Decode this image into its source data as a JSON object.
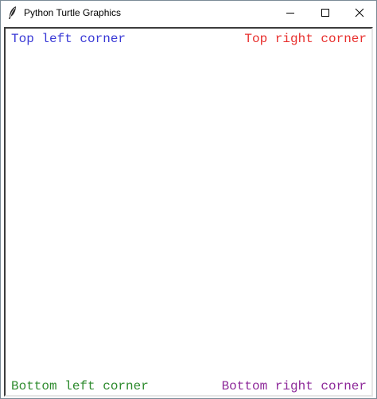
{
  "window": {
    "title": "Python Turtle Graphics",
    "icon": "feather-icon",
    "controls": [
      "minimize-icon",
      "maximize-icon",
      "close-icon"
    ]
  },
  "canvas": {
    "texts": {
      "top_left": {
        "text": "Top left corner",
        "color": "#3a3ad6"
      },
      "top_right": {
        "text": "Top right corner",
        "color": "#e8312f"
      },
      "bottom_left": {
        "text": "Bottom left corner",
        "color": "#2e8b2e"
      },
      "bottom_right": {
        "text": "Bottom right corner",
        "color": "#8e2a9a"
      }
    }
  }
}
